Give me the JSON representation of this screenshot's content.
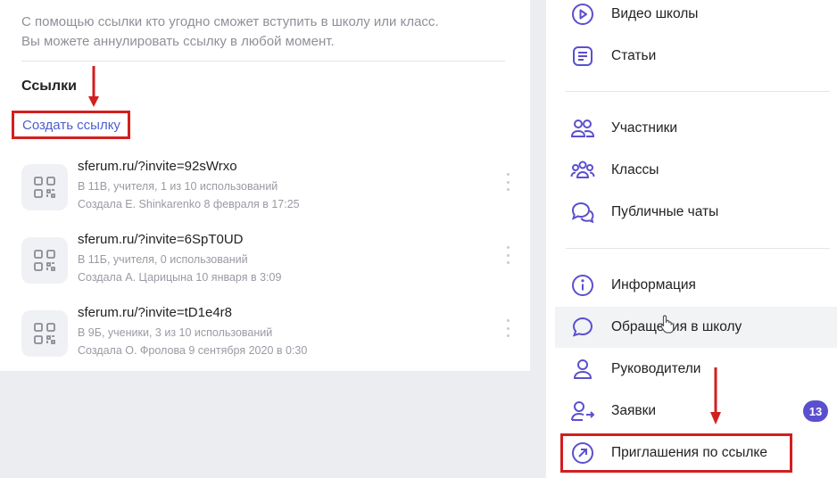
{
  "left": {
    "description_line1": "С помощью ссылки кто угодно сможет вступить в школу или класс.",
    "description_line2": "Вы можете аннулировать ссылку в любой момент.",
    "links_title": "Ссылки",
    "create_link_label": "Создать ссылку",
    "links": [
      {
        "url": "sferum.ru/?invite=92sWrxo",
        "meta": "В 11В, учителя, 1 из 10 использований",
        "creator": "Создала E. Shinkarenko 8 февраля в 17:25"
      },
      {
        "url": "sferum.ru/?invite=6SpT0UD",
        "meta": "В 11Б, учителя, 0 использований",
        "creator": "Создала А. Царицына 10 января в 3:09"
      },
      {
        "url": "sferum.ru/?invite=tD1e4r8",
        "meta": "В 9Б, ученики, 3 из 10 использований",
        "creator": "Создала О. Фролова 9 сентября 2020 в 0:30"
      }
    ]
  },
  "menu": {
    "items": [
      {
        "label": "Видео школы",
        "icon": "play-circle-icon"
      },
      {
        "label": "Статьи",
        "icon": "article-icon"
      },
      {
        "label": "Участники",
        "icon": "members-icon"
      },
      {
        "label": "Классы",
        "icon": "classes-icon"
      },
      {
        "label": "Публичные чаты",
        "icon": "chats-icon"
      },
      {
        "label": "Информация",
        "icon": "info-icon"
      },
      {
        "label": "Обращения в школу",
        "icon": "message-icon"
      },
      {
        "label": "Руководители",
        "icon": "user-icon"
      },
      {
        "label": "Заявки",
        "icon": "user-add-icon"
      },
      {
        "label": "Приглашения по ссылке",
        "icon": "arrow-circle-icon"
      }
    ],
    "requests_badge": "13"
  },
  "colors": {
    "accent": "#5a4fcf",
    "annotation_red": "#d21f1f",
    "link_blue": "#4a5fd1"
  }
}
